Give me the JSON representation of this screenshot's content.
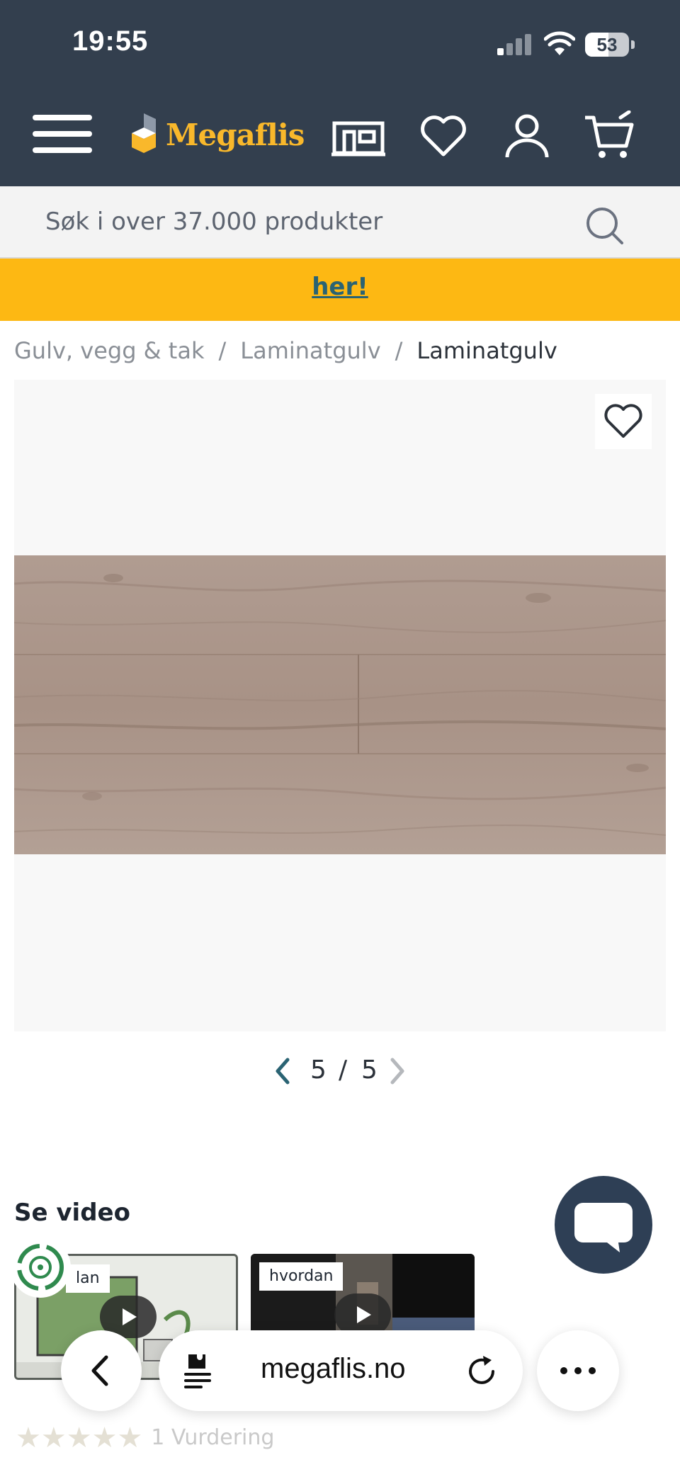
{
  "status_bar": {
    "time": "19:55",
    "battery": "53",
    "battery_level": 0.53
  },
  "header": {
    "logo_text": "Megaflis",
    "icons": [
      "menu-icon",
      "store-icon",
      "heart-icon",
      "user-icon",
      "cart-icon"
    ]
  },
  "search": {
    "placeholder": "Søk i over 37.000 produkter"
  },
  "banner": {
    "link_text": "her!"
  },
  "breadcrumb": {
    "items": [
      "Gulv, vegg & tak",
      "Laminatgulv"
    ],
    "current": "Laminatgulv",
    "separator": "/"
  },
  "gallery": {
    "current": "5",
    "total": "5",
    "separator": "/"
  },
  "video_section": {
    "title": "Se video",
    "cards": [
      {
        "label": "lan"
      },
      {
        "label": "hvordan"
      }
    ]
  },
  "browser": {
    "url": "megaflis.no"
  },
  "rating": {
    "stars_filled": 0,
    "text": "1 Vurdering"
  },
  "colors": {
    "header_bg": "#333f4e",
    "brand_yellow": "#f9b82b",
    "banner_yellow": "#fdb813",
    "link_teal": "#2a6373",
    "chat_bg": "#2e3f55"
  }
}
